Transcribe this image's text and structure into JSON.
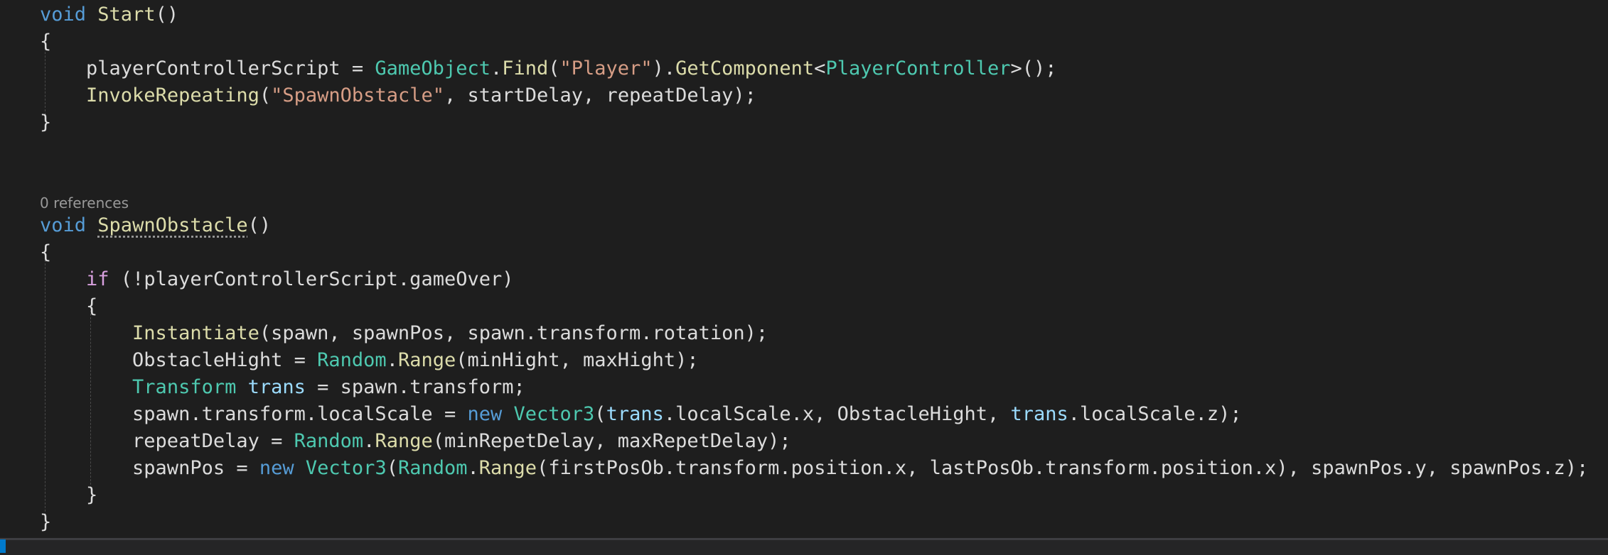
{
  "editor": {
    "code_lens": "0 references",
    "lines": [
      {
        "tokens": [
          {
            "t": "void",
            "c": "kw"
          },
          {
            "t": " ",
            "c": "plain"
          },
          {
            "t": "Start",
            "c": "fn"
          },
          {
            "t": "()",
            "c": "plain"
          }
        ]
      },
      {
        "tokens": [
          {
            "t": "{",
            "c": "plain"
          }
        ]
      },
      {
        "tokens": [
          {
            "t": "    playerControllerScript = ",
            "c": "plain"
          },
          {
            "t": "GameObject",
            "c": "type"
          },
          {
            "t": ".",
            "c": "plain"
          },
          {
            "t": "Find",
            "c": "fn"
          },
          {
            "t": "(",
            "c": "plain"
          },
          {
            "t": "\"Player\"",
            "c": "str"
          },
          {
            "t": ").",
            "c": "plain"
          },
          {
            "t": "GetComponent",
            "c": "fn"
          },
          {
            "t": "<",
            "c": "plain"
          },
          {
            "t": "PlayerController",
            "c": "type"
          },
          {
            "t": ">();",
            "c": "plain"
          }
        ]
      },
      {
        "tokens": [
          {
            "t": "    ",
            "c": "plain"
          },
          {
            "t": "InvokeRepeating",
            "c": "fn"
          },
          {
            "t": "(",
            "c": "plain"
          },
          {
            "t": "\"SpawnObstacle\"",
            "c": "str"
          },
          {
            "t": ", startDelay, repeatDelay);",
            "c": "plain"
          }
        ]
      },
      {
        "tokens": [
          {
            "t": "}",
            "c": "plain"
          }
        ]
      },
      {
        "tokens": []
      },
      {
        "tokens": []
      },
      {
        "tokens": [
          {
            "t": "void",
            "c": "kw"
          },
          {
            "t": " ",
            "c": "plain"
          },
          {
            "t": "SpawnObstacle",
            "c": "fn squiggle"
          },
          {
            "t": "()",
            "c": "plain"
          }
        ]
      },
      {
        "tokens": [
          {
            "t": "{",
            "c": "plain"
          }
        ]
      },
      {
        "tokens": [
          {
            "t": "    ",
            "c": "plain"
          },
          {
            "t": "if",
            "c": "kwc"
          },
          {
            "t": " (!playerControllerScript.gameOver)",
            "c": "plain"
          }
        ]
      },
      {
        "tokens": [
          {
            "t": "    {",
            "c": "plain"
          }
        ]
      },
      {
        "tokens": [
          {
            "t": "        ",
            "c": "plain"
          },
          {
            "t": "Instantiate",
            "c": "fn"
          },
          {
            "t": "(spawn, spawnPos, spawn.transform.rotation);",
            "c": "plain"
          }
        ]
      },
      {
        "tokens": [
          {
            "t": "        ObstacleHight = ",
            "c": "plain"
          },
          {
            "t": "Random",
            "c": "type"
          },
          {
            "t": ".",
            "c": "plain"
          },
          {
            "t": "Range",
            "c": "fn"
          },
          {
            "t": "(minHight, maxHight);",
            "c": "plain"
          }
        ]
      },
      {
        "tokens": [
          {
            "t": "        ",
            "c": "plain"
          },
          {
            "t": "Transform",
            "c": "type"
          },
          {
            "t": " ",
            "c": "plain"
          },
          {
            "t": "trans",
            "c": "var"
          },
          {
            "t": " = spawn.transform;",
            "c": "plain"
          }
        ]
      },
      {
        "tokens": [
          {
            "t": "        spawn.transform.localScale = ",
            "c": "plain"
          },
          {
            "t": "new",
            "c": "kw"
          },
          {
            "t": " ",
            "c": "plain"
          },
          {
            "t": "Vector3",
            "c": "type"
          },
          {
            "t": "(",
            "c": "plain"
          },
          {
            "t": "trans",
            "c": "var"
          },
          {
            "t": ".localScale.x, ObstacleHight, ",
            "c": "plain"
          },
          {
            "t": "trans",
            "c": "var"
          },
          {
            "t": ".localScale.z);",
            "c": "plain"
          }
        ]
      },
      {
        "tokens": [
          {
            "t": "        repeatDelay = ",
            "c": "plain"
          },
          {
            "t": "Random",
            "c": "type"
          },
          {
            "t": ".",
            "c": "plain"
          },
          {
            "t": "Range",
            "c": "fn"
          },
          {
            "t": "(minRepetDelay, maxRepetDelay);",
            "c": "plain"
          }
        ]
      },
      {
        "tokens": [
          {
            "t": "        spawnPos = ",
            "c": "plain"
          },
          {
            "t": "new",
            "c": "kw"
          },
          {
            "t": " ",
            "c": "plain"
          },
          {
            "t": "Vector3",
            "c": "type"
          },
          {
            "t": "(",
            "c": "plain"
          },
          {
            "t": "Random",
            "c": "type"
          },
          {
            "t": ".",
            "c": "plain"
          },
          {
            "t": "Range",
            "c": "fn"
          },
          {
            "t": "(firstPosOb.transform.position.x, lastPosOb.transform.position.x), spawnPos.y, spawnPos.z);",
            "c": "plain"
          }
        ]
      },
      {
        "tokens": [
          {
            "t": "    }",
            "c": "plain"
          }
        ]
      },
      {
        "tokens": [
          {
            "t": "}",
            "c": "plain"
          }
        ]
      }
    ]
  },
  "colors": {
    "background": "#1e1e1e",
    "keyword": "#569cd6",
    "control_keyword": "#d8a0df",
    "type": "#4ec9b0",
    "method": "#dcdcaa",
    "string": "#d69d85",
    "local_variable": "#9cdcfe",
    "text": "#dcdcdc"
  }
}
